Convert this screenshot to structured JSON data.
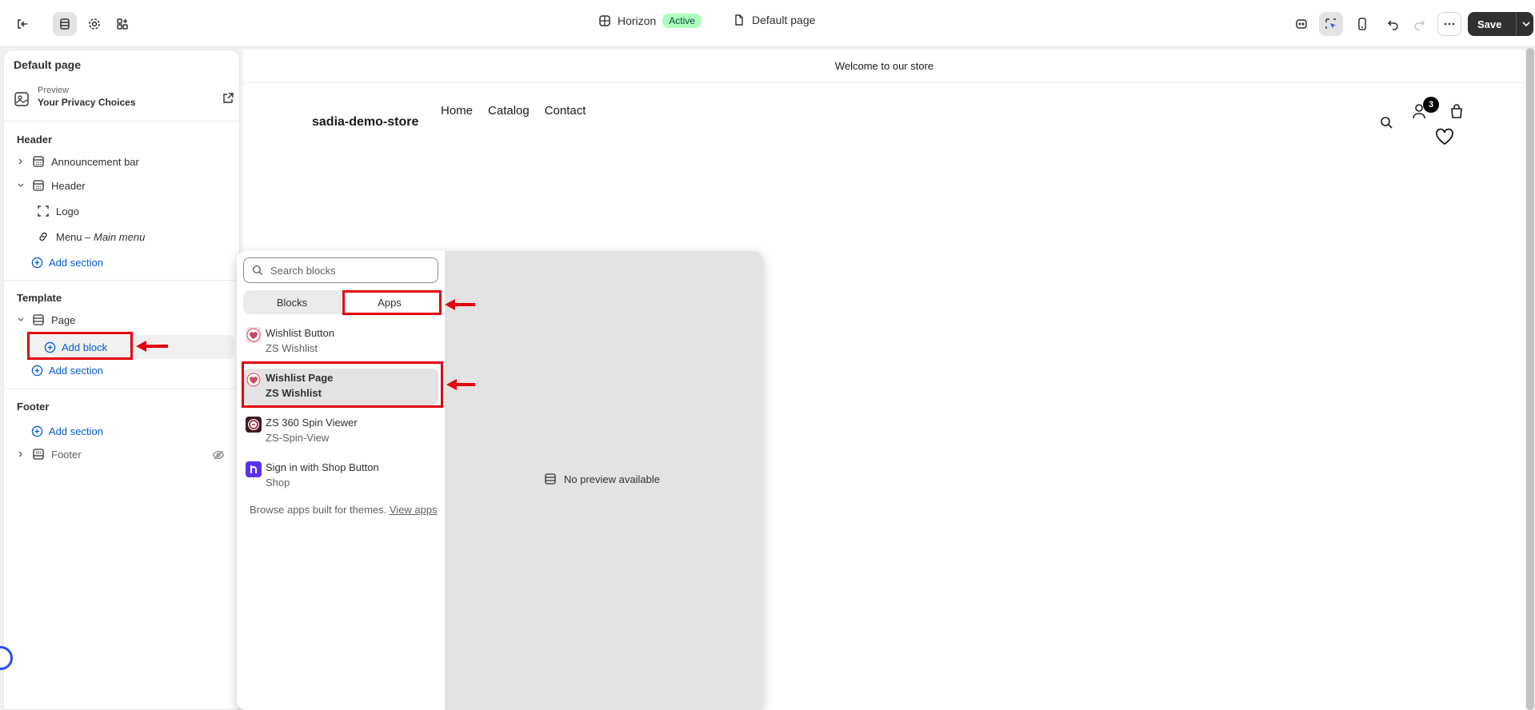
{
  "topbar": {
    "theme_name": "Horizon",
    "theme_status": "Active",
    "page_name": "Default page",
    "save_label": "Save"
  },
  "sidebar": {
    "title": "Default page",
    "preview_small": "Preview",
    "preview_big": "Your Privacy Choices",
    "header_group": "Header",
    "header_items": {
      "announcement_bar": "Announcement bar",
      "header": "Header",
      "logo": "Logo",
      "menu": "Menu",
      "menu_sep": " – ",
      "menu_sub": "Main menu"
    },
    "add_section": "Add section",
    "template_group": "Template",
    "page_item": "Page",
    "add_block": "Add block",
    "footer_group": "Footer",
    "footer_item": "Footer"
  },
  "store": {
    "announcement": "Welcome to our store",
    "name": "sadia-demo-store",
    "nav": [
      "Home",
      "Catalog",
      "Contact"
    ],
    "cart_count": "3"
  },
  "picker": {
    "search_placeholder": "Search blocks",
    "tabs": [
      "Blocks",
      "Apps"
    ],
    "selected_tab": "Apps",
    "apps": [
      {
        "name": "Wishlist Button",
        "sub": "ZS Wishlist",
        "icon": "zs-wishlist-heart-icon",
        "color": "#c94d63"
      },
      {
        "name": "Wishlist Page",
        "sub": "ZS Wishlist",
        "icon": "zs-wishlist-heart-icon",
        "color": "#c94d63"
      },
      {
        "name": "ZS 360 Spin Viewer",
        "sub": "ZS-Spin-View",
        "icon": "zs-spin-360-icon",
        "color": "#b0263c"
      },
      {
        "name": "Sign in with Shop Button",
        "sub": "Shop",
        "icon": "shop-logo-icon",
        "color": "#5a31f4"
      }
    ],
    "selected_app": "Wishlist Page",
    "browse_text": "Browse apps built for themes.",
    "browse_link": "View apps",
    "no_preview": "No preview available"
  },
  "colors": {
    "accent_link": "#005bd3",
    "annotation_red": "#e4000f",
    "active_badge": "#affebf"
  }
}
